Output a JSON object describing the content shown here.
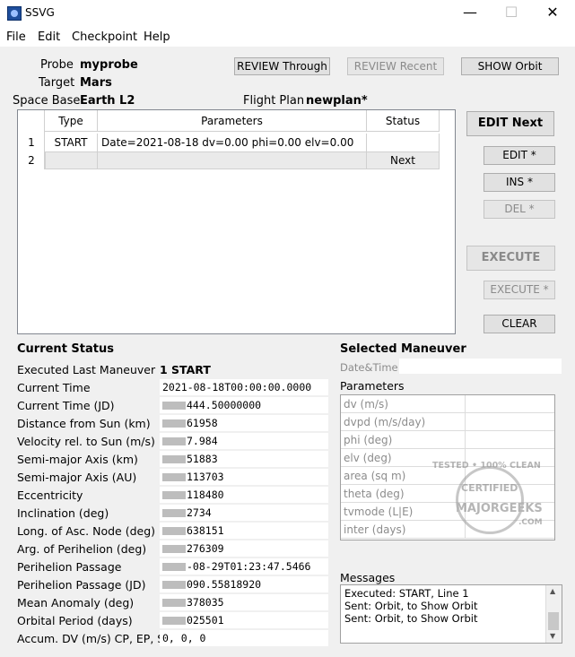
{
  "window": {
    "title": "SSVG",
    "minimize": "—",
    "maximize": "☐",
    "close": "✕"
  },
  "menu": [
    "File",
    "Edit",
    "Checkpoint",
    "Help"
  ],
  "header": {
    "probe_label": "Probe",
    "probe_value": "myprobe",
    "target_label": "Target",
    "target_value": "Mars",
    "base_label": "Space Base",
    "base_value": "Earth L2",
    "flightplan_label": "Flight Plan",
    "flightplan_value": "newplan*"
  },
  "top_buttons": {
    "review_through": "REVIEW Through",
    "review_recent": "REVIEW Recent",
    "show_orbit": "SHOW Orbit"
  },
  "plan_table": {
    "headers": [
      "Type",
      "Parameters",
      "Status"
    ],
    "rows": [
      {
        "num": "1",
        "type": "START",
        "params": "Date=2021-08-18 dv=0.00 phi=0.00 elv=0.00",
        "status": ""
      },
      {
        "num": "2",
        "type": "",
        "params": "",
        "status": "Next"
      }
    ]
  },
  "side_buttons": {
    "edit_next": "EDIT Next",
    "edit": "EDIT *",
    "ins": "INS *",
    "del": "DEL *",
    "execute": "EXECUTE",
    "execute_star": "EXECUTE *",
    "clear": "CLEAR"
  },
  "current_status": {
    "title": "Current Status",
    "exec_label": "Executed Last Maneuver",
    "exec_value": "1 START",
    "rows": [
      {
        "label": "Current Time",
        "value": "2021-08-18T00:00:00.0000",
        "redacted": false
      },
      {
        "label": "Current Time (JD)",
        "value": "444.50000000",
        "redacted": true
      },
      {
        "label": "Distance from Sun (km)",
        "value": "61958",
        "redacted": true
      },
      {
        "label": "Velocity rel. to Sun (m/s)",
        "value": "7.984",
        "redacted": true
      },
      {
        "label": "Semi-major Axis (km)",
        "value": "51883",
        "redacted": true
      },
      {
        "label": "Semi-major Axis (AU)",
        "value": "113703",
        "redacted": true
      },
      {
        "label": "Eccentricity",
        "value": "118480",
        "redacted": true
      },
      {
        "label": "Inclination (deg)",
        "value": "2734",
        "redacted": true
      },
      {
        "label": "Long. of Asc. Node (deg)",
        "value": "638151",
        "redacted": true
      },
      {
        "label": "Arg. of Perihelion (deg)",
        "value": "276309",
        "redacted": true
      },
      {
        "label": "Perihelion Passage",
        "value": "-08-29T01:23:47.5466",
        "redacted": true
      },
      {
        "label": "Perihelion Passage (JD)",
        "value": "090.55818920",
        "redacted": true
      },
      {
        "label": "Mean Anomaly (deg)",
        "value": "378035",
        "redacted": true
      },
      {
        "label": "Orbital Period (days)",
        "value": "025501",
        "redacted": true
      },
      {
        "label": "Accum. DV (m/s) CP, EP, SS",
        "value": "0,  0,  0",
        "redacted": false
      }
    ]
  },
  "selected_maneuver": {
    "title": "Selected Maneuver",
    "datetime_label": "Date&Time",
    "params_title": "Parameters",
    "params": [
      "dv (m/s)",
      "dvpd (m/s/day)",
      "phi (deg)",
      "elv (deg)",
      "area (sq m)",
      "theta (deg)",
      "tvmode (L|E)",
      "inter (days)"
    ]
  },
  "messages": {
    "title": "Messages",
    "lines": [
      "Executed: START, Line 1",
      "Sent: Orbit, to Show Orbit",
      "Sent: Orbit, to Show Orbit"
    ]
  },
  "watermark": {
    "line1": "TESTED • 100% CLEAN",
    "line2": "CERTIFIED",
    "line3": "MAJORGEEKS",
    "line4": ".COM"
  },
  "colors": {
    "accent": "#1f4e9c",
    "button_bg": "#e1e1e1",
    "grid_row_highlight": "#eaeaea"
  }
}
